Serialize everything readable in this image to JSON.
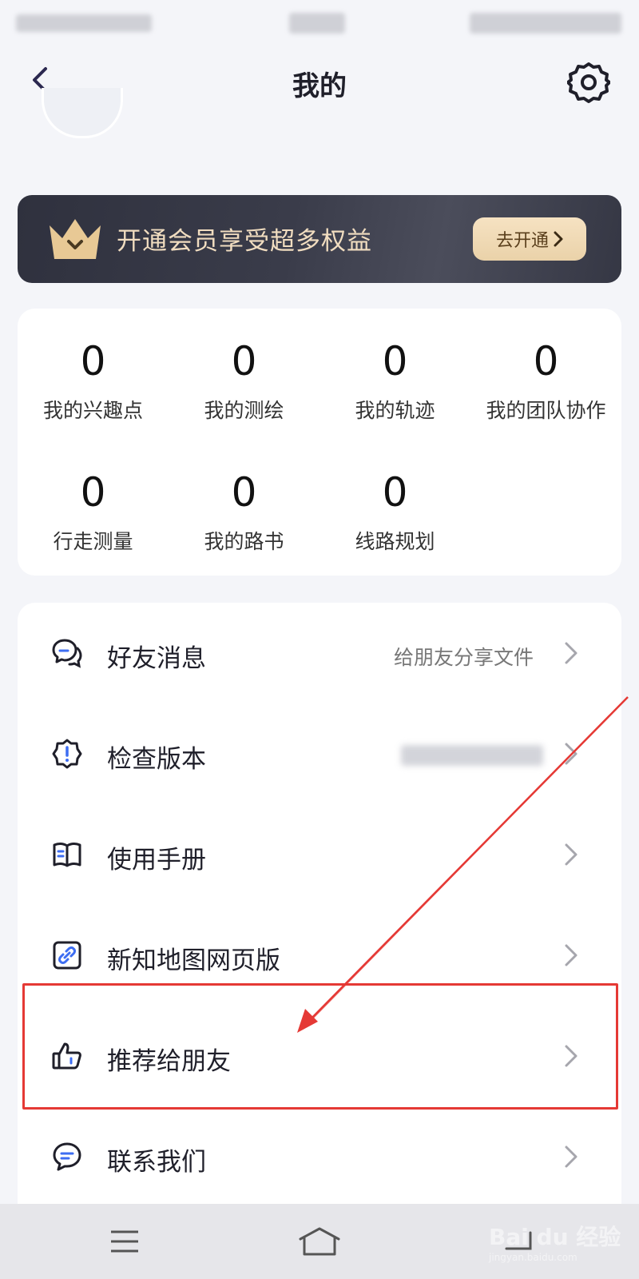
{
  "header": {
    "title": "我的"
  },
  "vip": {
    "text": "开通会员享受超多权益",
    "button_label": "去开通"
  },
  "stats": [
    {
      "value": "0",
      "label": "我的兴趣点"
    },
    {
      "value": "0",
      "label": "我的测绘"
    },
    {
      "value": "0",
      "label": "我的轨迹"
    },
    {
      "value": "0",
      "label": "我的团队协作"
    },
    {
      "value": "0",
      "label": "行走测量"
    },
    {
      "value": "0",
      "label": "我的路书"
    },
    {
      "value": "0",
      "label": "线路规划"
    }
  ],
  "menu": [
    {
      "label": "好友消息",
      "value": "给朋友分享文件",
      "icon": "chat-bubbles-icon"
    },
    {
      "label": "检查版本",
      "value": "",
      "icon": "badge-alert-icon"
    },
    {
      "label": "使用手册",
      "value": "",
      "icon": "book-icon"
    },
    {
      "label": "新知地图网页版",
      "value": "",
      "icon": "link-icon"
    },
    {
      "label": "推荐给朋友",
      "value": "",
      "icon": "thumbs-up-icon"
    },
    {
      "label": "联系我们",
      "value": "",
      "icon": "message-icon"
    }
  ],
  "watermark": {
    "brand": "Bai du 经验",
    "url": "jingyan.baidu.com"
  },
  "colors": {
    "accent": "#1f1f2a",
    "vip_text": "#f1ddc0",
    "highlight": "#e53935"
  }
}
